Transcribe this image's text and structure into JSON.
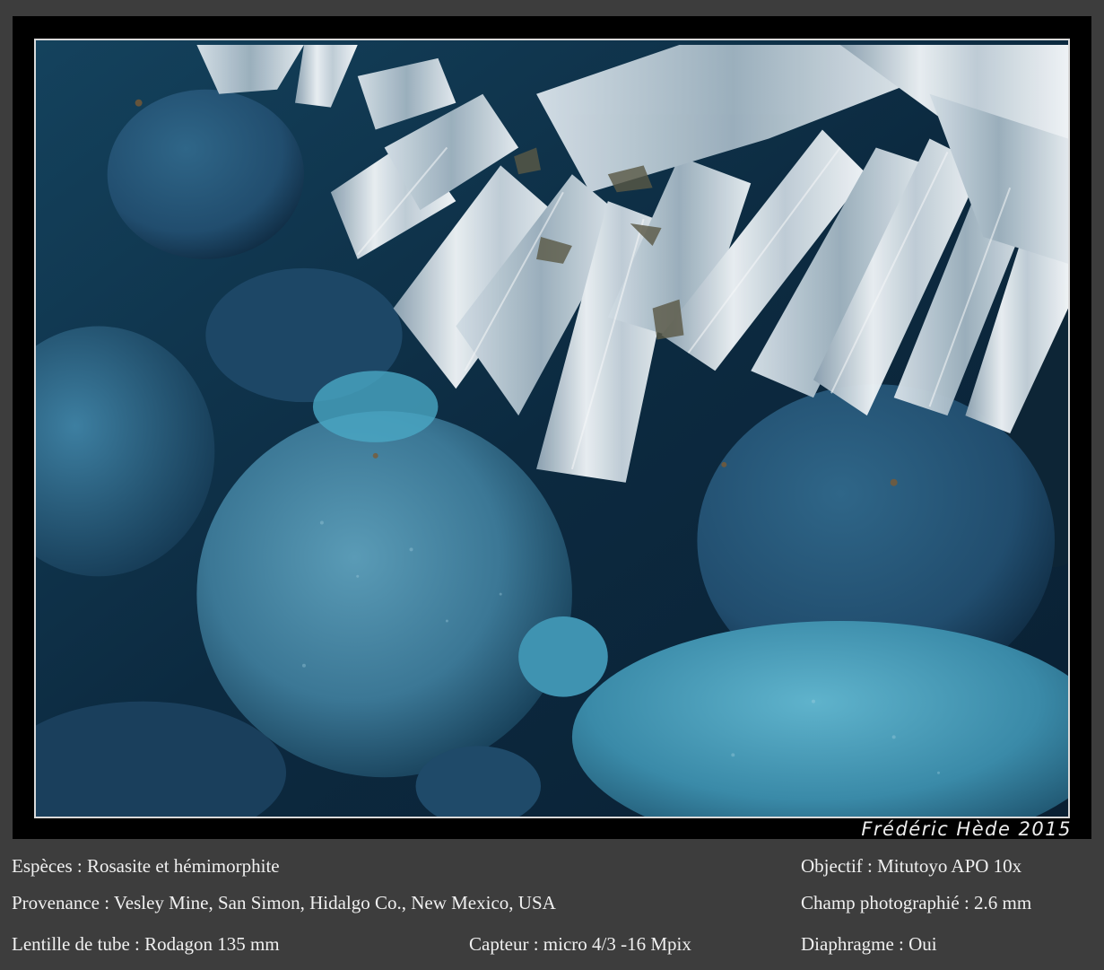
{
  "signature": "Frédéric Hède 2015",
  "caption": {
    "especes": "Espèces : Rosasite et hémimorphite",
    "objectif": "Objectif : Mitutoyo APO 10x",
    "provenance": "Provenance : Vesley Mine, San Simon,  Hidalgo Co.,  New Mexico,  USA",
    "champ": "Champ photographié : 2.6 mm",
    "lentille": "Lentille de tube : Rodagon 135 mm",
    "capteur": "Capteur : micro 4/3 -16 Mpix",
    "diaphragme": "Diaphragme : Oui"
  },
  "colors": {
    "page_background": "#3d3d3d",
    "frame": "#000000",
    "caption_text": "#f0f0f0",
    "rosasite_blue": "#3f7f9d",
    "hemimorphite_white": "#e8eef2"
  }
}
